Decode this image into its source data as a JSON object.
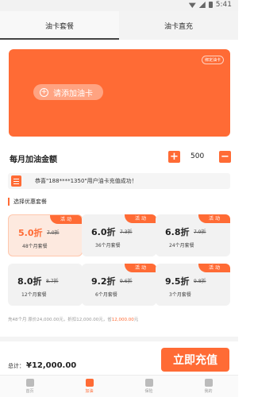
{
  "status_bar": {
    "time": "5:41"
  },
  "tabs": [
    {
      "label": "油卡套餐",
      "active": true
    },
    {
      "label": "油卡直充",
      "active": false
    }
  ],
  "card": {
    "tag": "绑定油卡",
    "add_card_label": "请添加油卡",
    "color": "#ff6b35"
  },
  "monthly": {
    "label": "每月加油金额",
    "value": "500",
    "minus": "+",
    "plus": "−"
  },
  "notice": {
    "text": "恭喜\"188****1350\"用户油卡充值成功！"
  },
  "packages": {
    "section_title": "选择优惠套餐",
    "items": [
      {
        "discount": "5.0折",
        "original": "7.0折",
        "months": "48个月套餐",
        "tag": "活 动",
        "selected": true
      },
      {
        "discount": "6.0折",
        "original": "7.3折",
        "months": "36个月套餐",
        "tag": "活 动",
        "selected": false
      },
      {
        "discount": "6.8折",
        "original": "7.9折",
        "months": "24个月套餐",
        "tag": "活 动",
        "selected": false
      },
      {
        "discount": "8.0折",
        "original": "8.7折",
        "months": "12个月套餐",
        "tag": "",
        "selected": false
      },
      {
        "discount": "9.2折",
        "original": "9.6折",
        "months": "6个月套餐",
        "tag": "活 动",
        "selected": false
      },
      {
        "discount": "9.5折",
        "original": "9.8折",
        "months": "3个月套餐",
        "tag": "活 动",
        "selected": false
      }
    ]
  },
  "summary": {
    "prefix": "充48个月 原价24,000.00元，折扣12,000.00元，省",
    "saved": "12,000.00",
    "suffix": "元"
  },
  "total": {
    "label": "总计：",
    "amount": "¥12,000.00"
  },
  "recharge_button": "立即充值",
  "bottom_nav": [
    {
      "label": "首页",
      "active": false
    },
    {
      "label": "加油",
      "active": true
    },
    {
      "label": "保险",
      "active": false
    },
    {
      "label": "我的",
      "active": false
    }
  ]
}
